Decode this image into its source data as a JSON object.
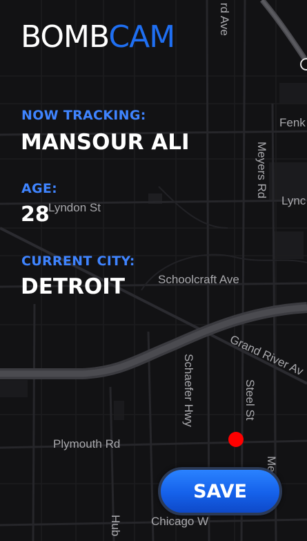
{
  "app": {
    "logo_part1": "BOMB",
    "logo_part2": "CAM"
  },
  "tracking": {
    "label": "NOW TRACKING:",
    "name": "MANSOUR ALI"
  },
  "age": {
    "label": "AGE:",
    "value": "28"
  },
  "city": {
    "label": "CURRENT CITY:",
    "value": "DETROIT"
  },
  "actions": {
    "save_label": "SAVE"
  },
  "map": {
    "streets": {
      "ward_ave": "rd Ave",
      "fenkell": "Fenk",
      "meyers_rd": "Meyers Rd",
      "lyndon_st": "Lyndon St",
      "lyndon_right": "Lync",
      "schoolcraft_ave": "Schoolcraft Ave",
      "grand_river_ave": "Grand River Av",
      "schaefer_hwy": "Schaefer Hwy",
      "steel_st": "Steel St",
      "plymouth_rd": "Plymouth Rd",
      "meyers_rd_lower": "Me  Rd",
      "hubbell": "Hub",
      "chicago": "Chicago W"
    }
  },
  "colors": {
    "accent": "#1f6ff2",
    "label": "#3f84ff",
    "marker": "#ff0000",
    "background": "#111113"
  }
}
